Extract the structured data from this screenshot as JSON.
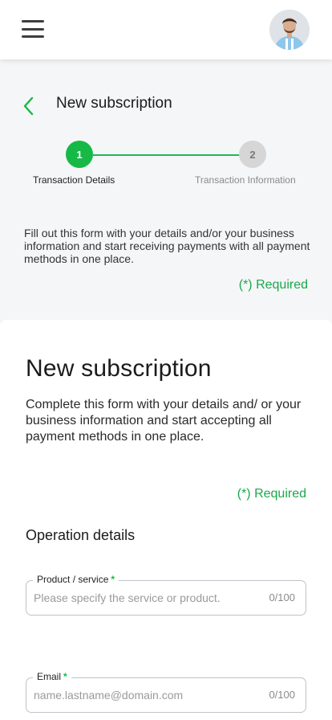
{
  "header": {
    "menu_icon": "hamburger-menu-icon",
    "avatar_icon": "user-avatar"
  },
  "page": {
    "title": "New subscription",
    "back_icon": "chevron-left-icon",
    "accent_color": "#16b945"
  },
  "stepper": {
    "steps": [
      {
        "number": "1",
        "label": "Transaction Details",
        "state": "active"
      },
      {
        "number": "2",
        "label": "Transaction Information",
        "state": "inactive"
      }
    ]
  },
  "intro": {
    "text": "Fill out this form with your details and/or your business information and start receiving payments with all payment methods in one place.",
    "required_note": "(*) Required"
  },
  "card": {
    "title": "New subscription",
    "description": "Complete this form with your details and/ or your business information and start accepting all payment methods in one place.",
    "required_note": "(*) Required",
    "section_title": "Operation details",
    "fields": [
      {
        "label": "Product / service",
        "required_mark": "*",
        "placeholder": "Please specify the service or product.",
        "value": "",
        "counter": "0/100"
      },
      {
        "label": "Email",
        "required_mark": "*",
        "placeholder": "name.lastname@domain.com",
        "value": "",
        "counter": "0/100"
      }
    ]
  }
}
